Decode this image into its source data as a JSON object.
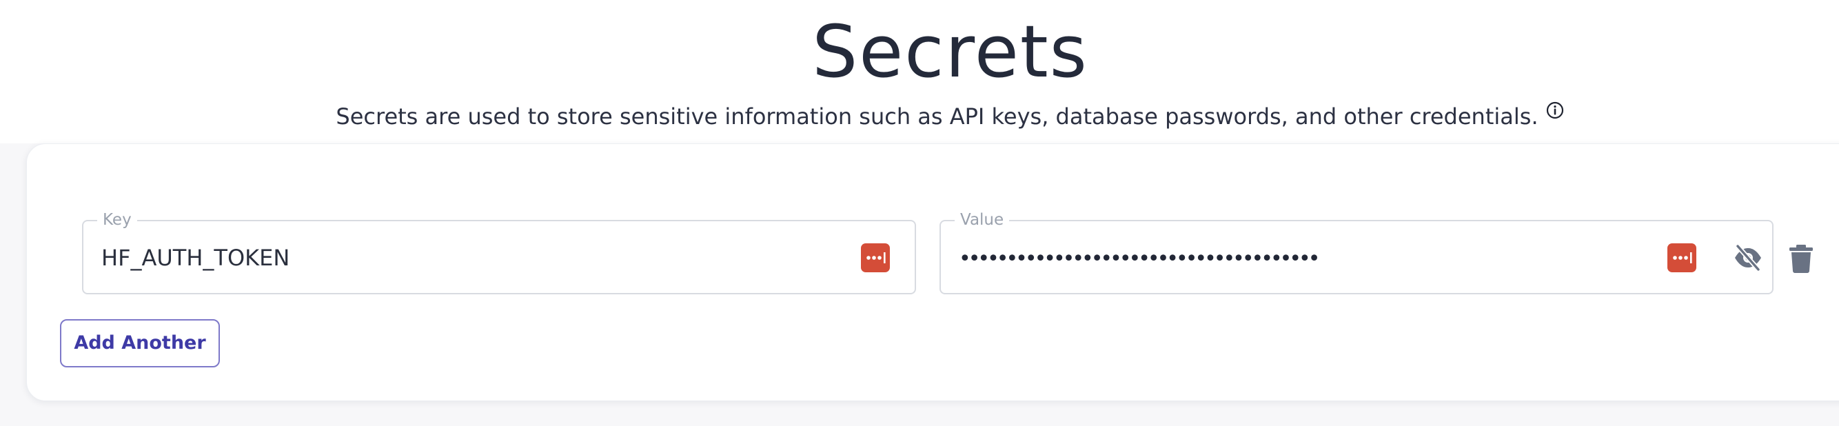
{
  "header": {
    "title": "Secrets",
    "description": "Secrets are used to store sensitive information such as API keys, database passwords, and other credentials.",
    "info_icon": "info-circle-icon"
  },
  "secrets": [
    {
      "key_label": "Key",
      "key_value": "HF_AUTH_TOKEN",
      "value_label": "Value",
      "value_masked": "••••••••••••••••••••••••••••••••••••••",
      "key_autofill_icon": "password-manager-icon",
      "value_autofill_icon": "password-manager-icon",
      "visibility_icon": "eye-slash-icon",
      "delete_icon": "trash-icon"
    }
  ],
  "actions": {
    "add_another_label": "Add Another"
  },
  "colors": {
    "accent": "#3e3aa6",
    "accent_border": "#7e79c9",
    "password_manager": "#d44d38",
    "icon_gray": "#697283"
  }
}
